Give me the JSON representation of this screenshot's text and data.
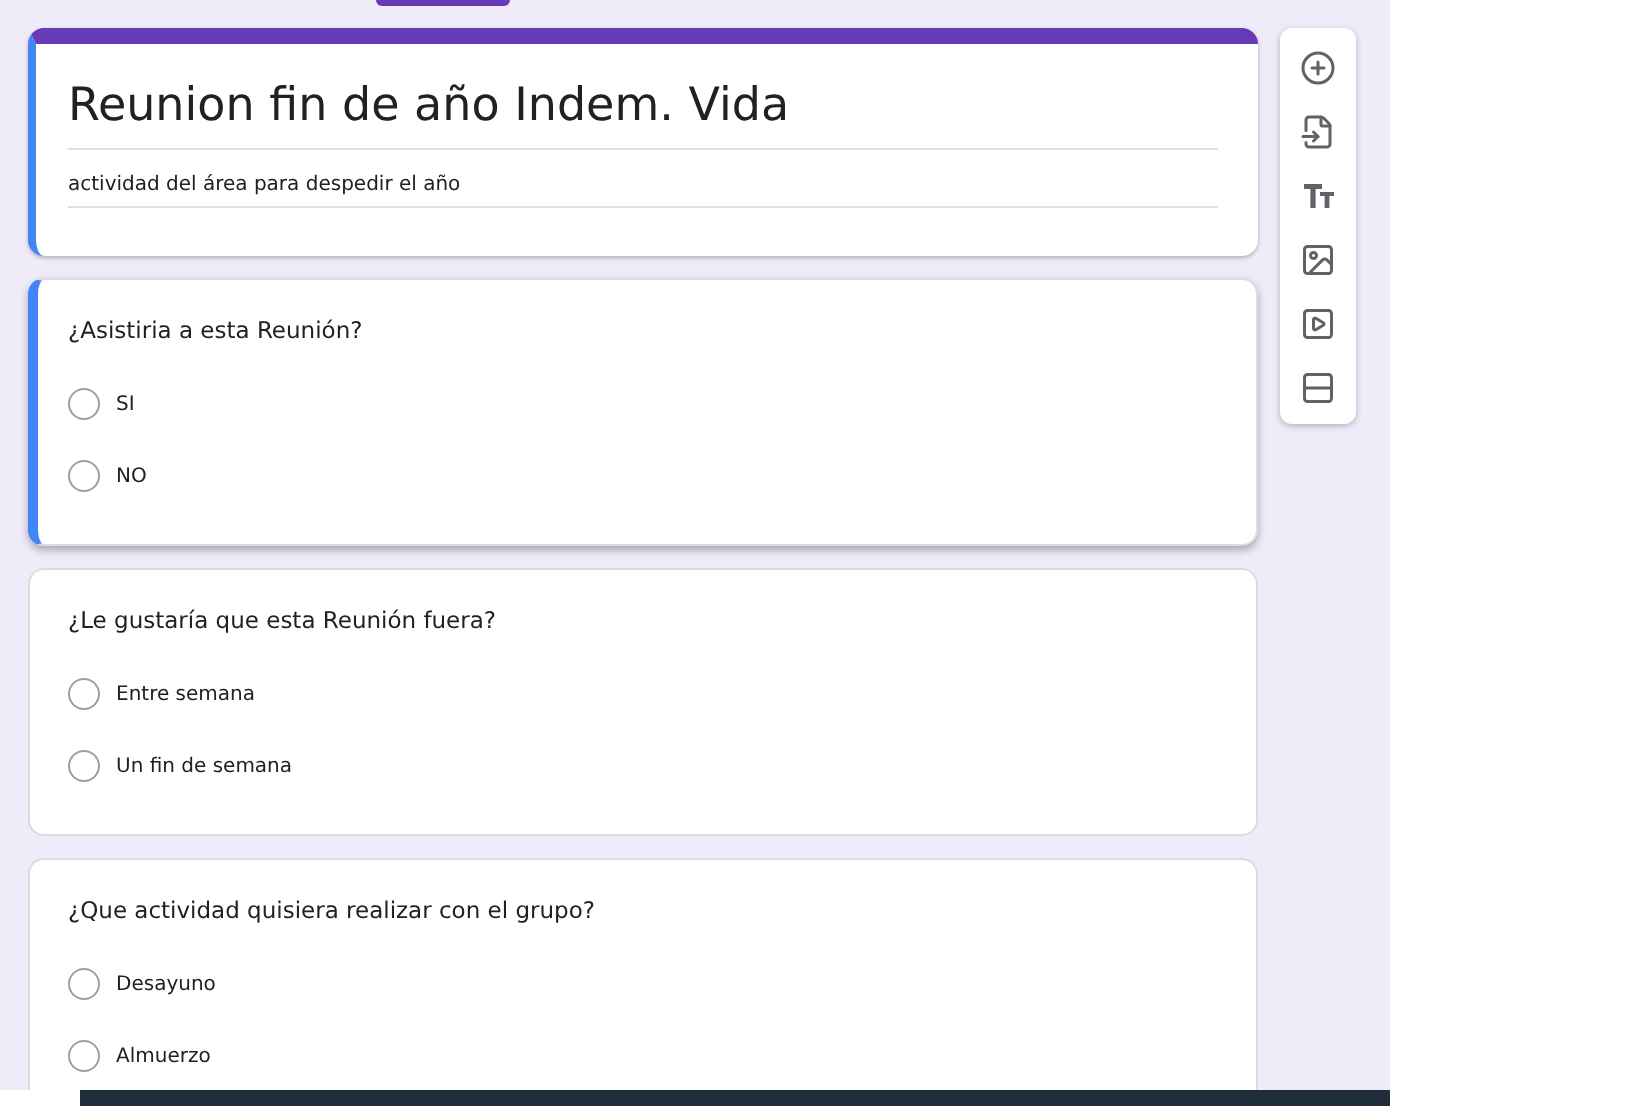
{
  "header": {
    "title": "Reunion fin de año Indem. Vida",
    "description": "actividad del área para despedir el año",
    "active": true
  },
  "questions": [
    {
      "text": "¿Asistiria a esta Reunión?",
      "active": true,
      "options": [
        {
          "label": "SI",
          "selected": false
        },
        {
          "label": "NO",
          "selected": false
        }
      ]
    },
    {
      "text": "¿Le gustaría que esta Reunión fuera?",
      "active": false,
      "options": [
        {
          "label": "Entre semana",
          "selected": false
        },
        {
          "label": "Un fin de semana",
          "selected": false
        }
      ]
    },
    {
      "text": "¿Que actividad quisiera realizar con el grupo?",
      "active": false,
      "options": [
        {
          "label": "Desayuno",
          "selected": false
        },
        {
          "label": "Almuerzo",
          "selected": false
        }
      ]
    }
  ],
  "toolbar": [
    {
      "kind": "add"
    },
    {
      "kind": "import"
    },
    {
      "kind": "title"
    },
    {
      "kind": "image"
    },
    {
      "kind": "video"
    },
    {
      "kind": "section"
    }
  ]
}
